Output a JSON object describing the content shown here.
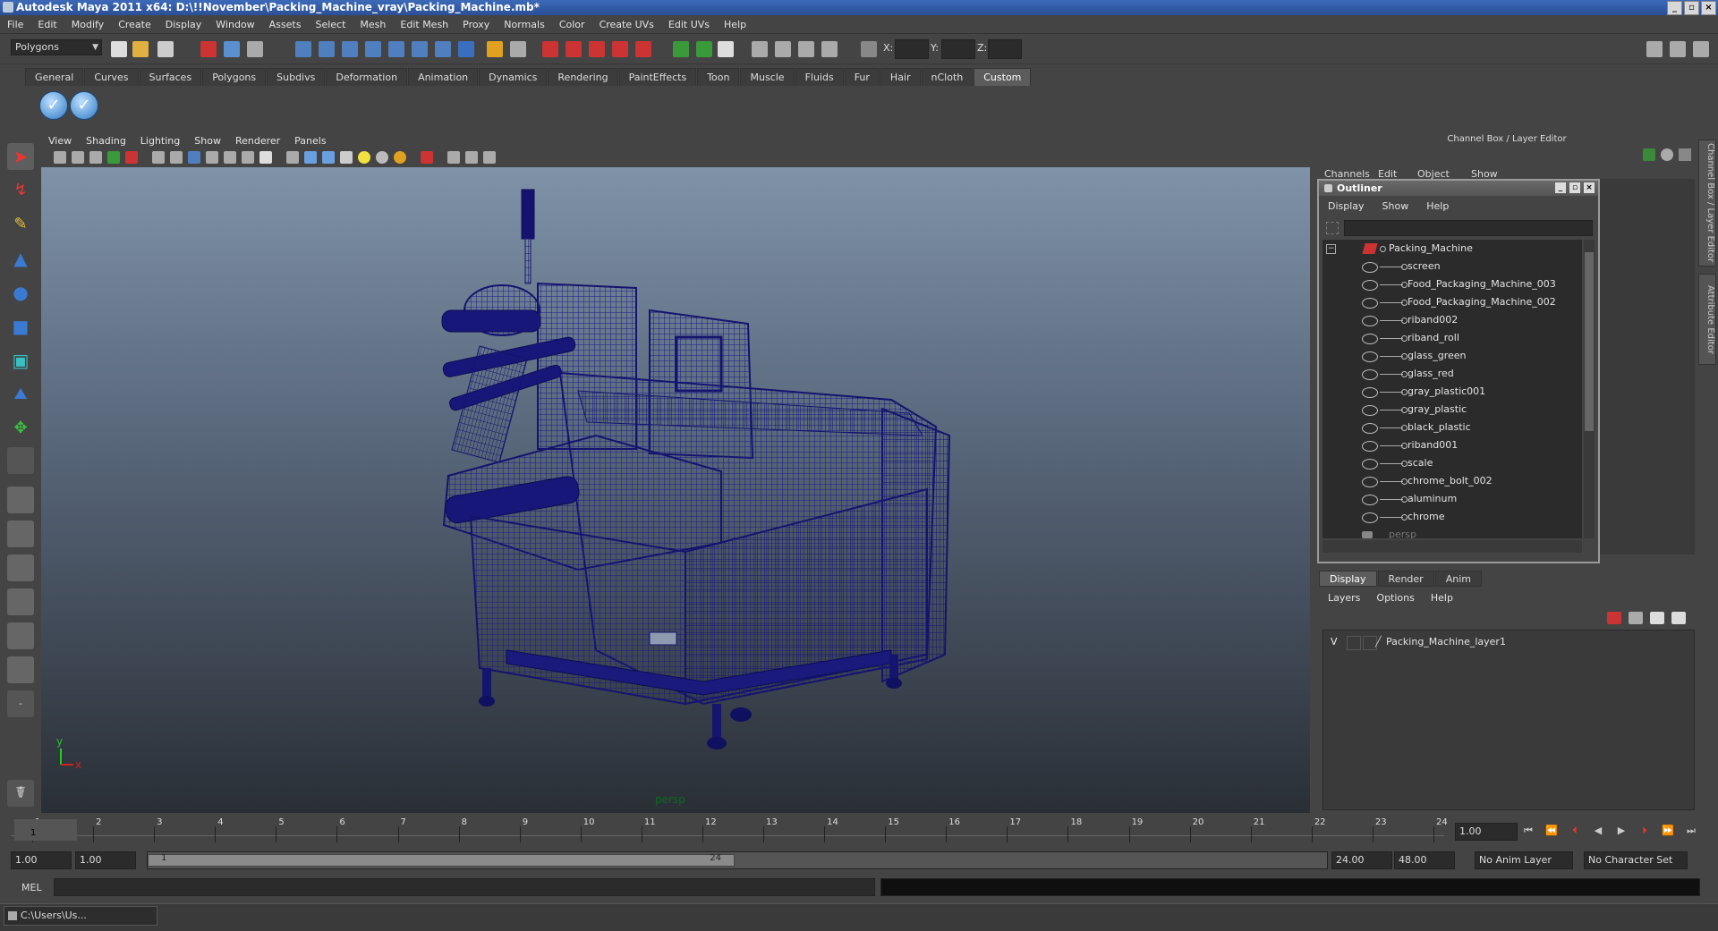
{
  "window": {
    "title": "Autodesk Maya 2011 x64: D:\\!!November\\Packing_Machine_vray\\Packing_Machine.mb*"
  },
  "menubar": [
    "File",
    "Edit",
    "Modify",
    "Create",
    "Display",
    "Window",
    "Assets",
    "Select",
    "Mesh",
    "Edit Mesh",
    "Proxy",
    "Normals",
    "Color",
    "Create UVs",
    "Edit UVs",
    "Help"
  ],
  "statusline": {
    "mode": "Polygons",
    "x_label": "X:",
    "y_label": "Y:",
    "z_label": "Z:"
  },
  "shelf": {
    "tabs": [
      "General",
      "Curves",
      "Surfaces",
      "Polygons",
      "Subdivs",
      "Deformation",
      "Animation",
      "Dynamics",
      "Rendering",
      "PaintEffects",
      "Toon",
      "Muscle",
      "Fluids",
      "Fur",
      "Hair",
      "nCloth",
      "Custom"
    ],
    "active_tab": "Custom"
  },
  "viewport": {
    "menu": [
      "View",
      "Shading",
      "Lighting",
      "Show",
      "Renderer",
      "Panels"
    ],
    "camera": "persp",
    "axis_y": "y",
    "axis_x": "x"
  },
  "channelbox": {
    "title": "Channel Box / Layer Editor",
    "menu": [
      "Channels",
      "Edit",
      "Object",
      "Show"
    ]
  },
  "side_tabs": [
    "Channel Box / Layer Editor",
    "Attribute Editor"
  ],
  "outliner": {
    "title": "Outliner",
    "menu": [
      "Display",
      "Show",
      "Help"
    ],
    "root": "Packing_Machine",
    "items": [
      "screen",
      "Food_Packaging_Machine_003",
      "Food_Packaging_Machine_002",
      "riband002",
      "riband_roll",
      "glass_green",
      "glass_red",
      "gray_plastic001",
      "gray_plastic",
      "black_plastic",
      "riband001",
      "scale",
      "chrome_bolt_002",
      "aluminum",
      "chrome"
    ],
    "partial_item": "persp"
  },
  "layer_editor": {
    "tabs": [
      "Display",
      "Render",
      "Anim"
    ],
    "active_tab": "Display",
    "menu": [
      "Layers",
      "Options",
      "Help"
    ],
    "layers": [
      {
        "visible": "V",
        "name": "Packing_Machine_layer1"
      }
    ]
  },
  "time_slider": {
    "ticks": [
      "1",
      "2",
      "3",
      "4",
      "5",
      "6",
      "7",
      "8",
      "9",
      "10",
      "11",
      "12",
      "13",
      "14",
      "15",
      "16",
      "17",
      "18",
      "19",
      "20",
      "21",
      "22",
      "23",
      "24"
    ],
    "current_frame_marker": "1",
    "current_frame": "1.00"
  },
  "range_slider": {
    "start_time": "1.00",
    "playback_start": "1.00",
    "range_start_label": "1",
    "range_end_label": "24",
    "playback_end": "24.00",
    "end_time": "48.00",
    "anim_layer": "No Anim Layer",
    "character_set": "No Character Set"
  },
  "command_line": {
    "label": "MEL"
  },
  "taskbar": {
    "item": "C:\\Users\\Us..."
  },
  "colors": {
    "wireframe": "#1a1a7a",
    "viewport_top": "#7f92a8",
    "viewport_bottom": "#2a2f36",
    "active_tab": "#5c5c5c",
    "accent": "#2e79c4"
  }
}
